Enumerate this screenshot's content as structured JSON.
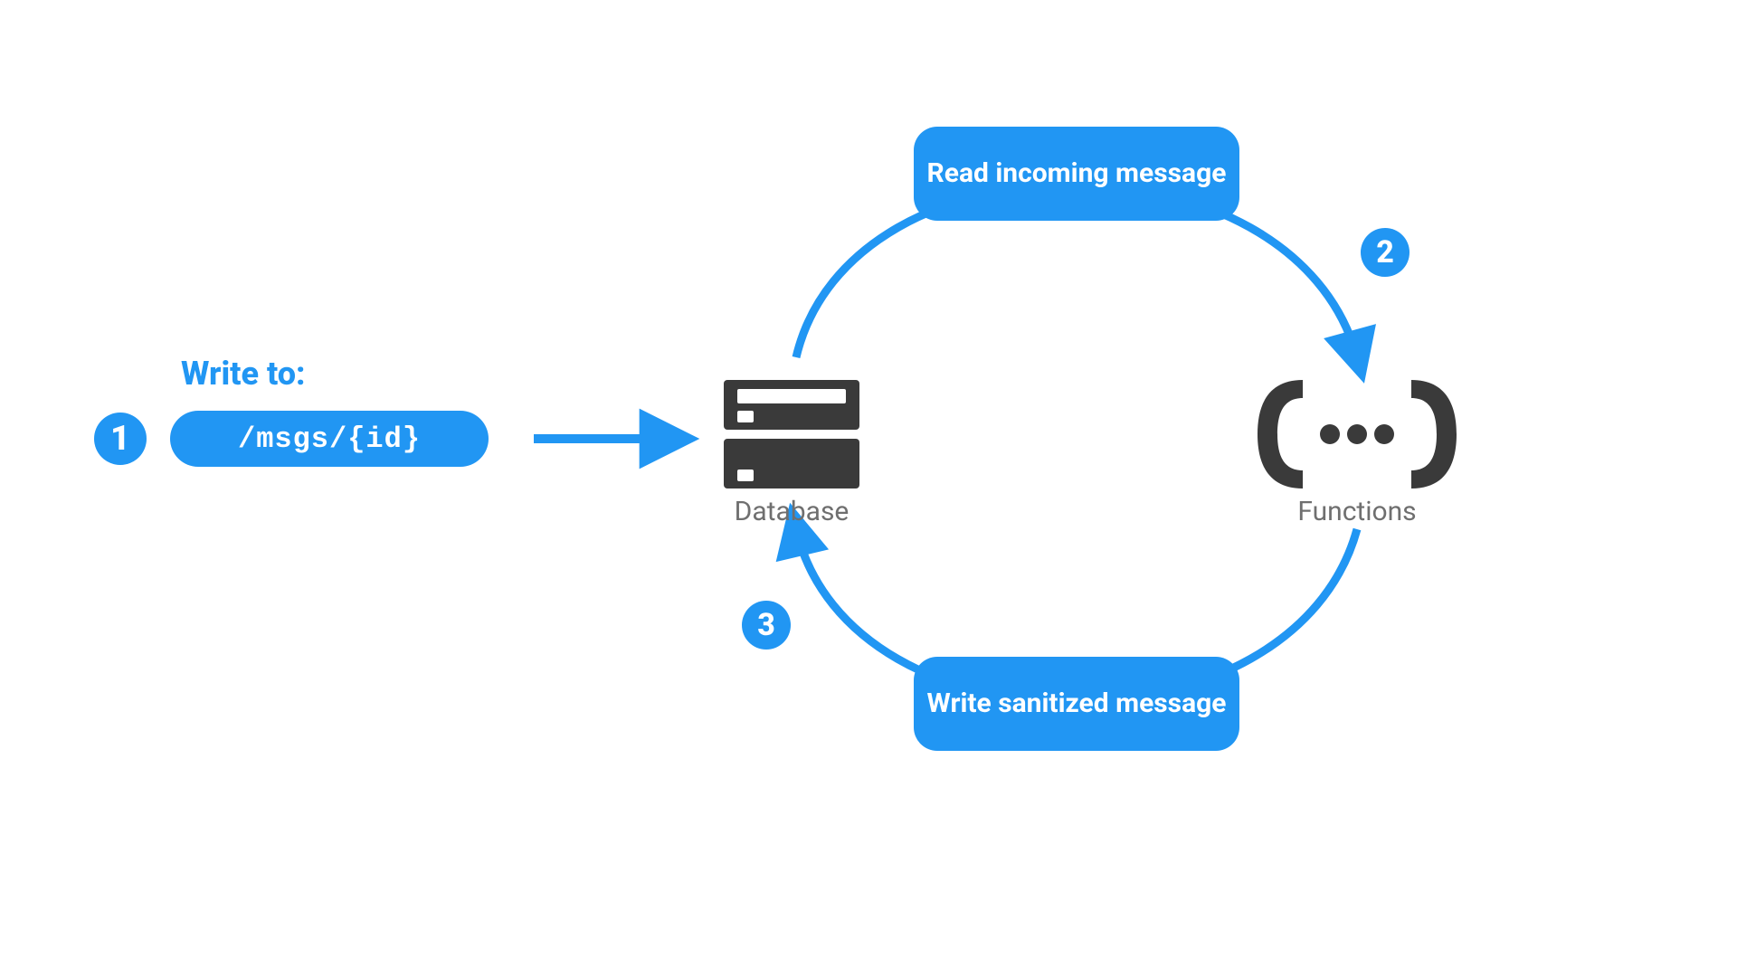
{
  "colors": {
    "accent": "#2196F3",
    "icon": "#3a3a3a",
    "text_gray": "#6f6f6f"
  },
  "write_to_label": "Write to:",
  "path_pill": "/msgs/{id}",
  "badges": {
    "one": "1",
    "two": "2",
    "three": "3"
  },
  "flow_top_label": "Read incoming message",
  "flow_bottom_label": "Write sanitized message",
  "nodes": {
    "database_label": "Database",
    "functions_label": "Functions"
  }
}
